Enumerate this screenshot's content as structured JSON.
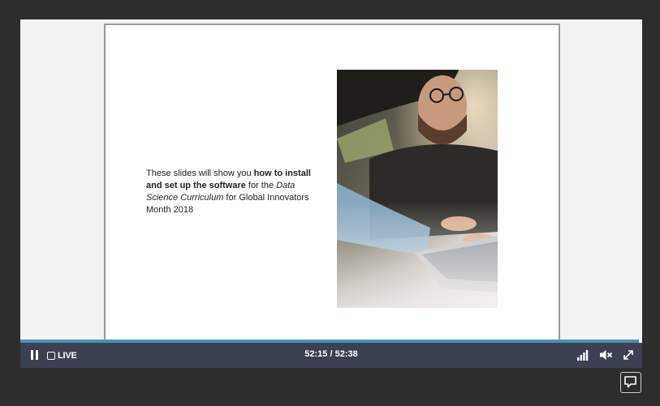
{
  "slide": {
    "text_1": "These slides will show you ",
    "text_bold": "how to install and set up the software",
    "text_2": " for the ",
    "text_italic": "Data Science Curriculum",
    "text_3": " for Global Innovators Month 2018",
    "image_description": "photo-man-with-glasses-using-laptop"
  },
  "controls": {
    "live_label": "LIVE",
    "time": "52:15 / 52:38",
    "progress_fraction": 0.993,
    "icons": [
      "pause-icon",
      "live-square-icon",
      "signal-bars-icon",
      "mute-icon",
      "expand-icon",
      "chat-icon"
    ],
    "accent_color": "#4a90b8",
    "bar_color": "#3b4150"
  }
}
